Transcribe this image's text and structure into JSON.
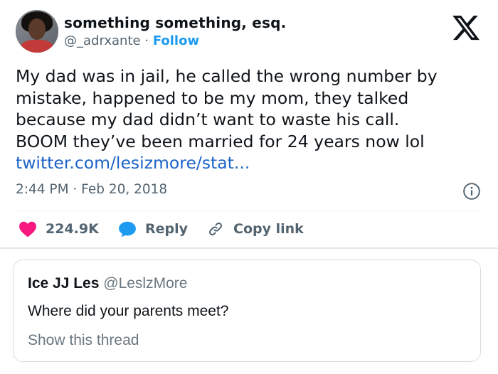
{
  "author": {
    "name": "something something, esq.",
    "handle": "@_adrxante",
    "separator": "·",
    "follow_label": "Follow"
  },
  "tweet": {
    "lines": [
      "My dad was in jail, he called the wrong number by",
      "mistake, happened to be my mom, they talked",
      "because my dad didn’t want to waste his call.",
      "BOOM they’ve been married for 24 years now lol"
    ],
    "link": "twitter.com/lesizmore/stat...",
    "time": "2:44 PM · Feb 20, 2018"
  },
  "actions": {
    "likes": "224.9K",
    "reply": "Reply",
    "copy_link": "Copy link"
  },
  "quoted": {
    "name": "Ice JJ Les",
    "handle": "@LeslzMore",
    "text": "Where did your parents meet?",
    "show_thread": "Show this thread"
  },
  "colors": {
    "like": "#f91880",
    "reply": "#1d9bf0",
    "link": "#1d63c8",
    "muted": "#536471"
  },
  "icons": [
    "x-logo-icon",
    "info-icon",
    "heart-icon",
    "reply-bubble-icon",
    "link-icon"
  ]
}
